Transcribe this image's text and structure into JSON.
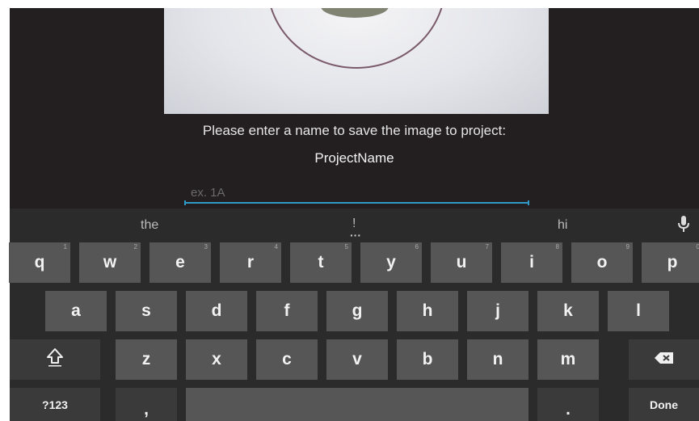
{
  "dialog": {
    "prompt": "Please enter a name to save the image to project:",
    "project_name": "ProjectName",
    "input": {
      "value": "",
      "placeholder": "ex. 1A"
    }
  },
  "keyboard": {
    "suggestions": {
      "left": "the",
      "center": "!",
      "right": "hi"
    },
    "row1": [
      {
        "label": "q",
        "hint": "1"
      },
      {
        "label": "w",
        "hint": "2"
      },
      {
        "label": "e",
        "hint": "3"
      },
      {
        "label": "r",
        "hint": "4"
      },
      {
        "label": "t",
        "hint": "5"
      },
      {
        "label": "y",
        "hint": "6"
      },
      {
        "label": "u",
        "hint": "7"
      },
      {
        "label": "i",
        "hint": "8"
      },
      {
        "label": "o",
        "hint": "9"
      },
      {
        "label": "p",
        "hint": "0"
      }
    ],
    "row2": [
      "a",
      "s",
      "d",
      "f",
      "g",
      "h",
      "j",
      "k",
      "l"
    ],
    "row3": [
      "z",
      "x",
      "c",
      "v",
      "b",
      "n",
      "m"
    ],
    "bottom": {
      "symbols": "?123",
      "comma": ",",
      "period": ".",
      "done": "Done"
    }
  },
  "colors": {
    "accent": "#2f9ac8",
    "key": "#565656",
    "key_dark": "#3a3a3a",
    "keyboard_bg": "#2b2b2b",
    "dialog_bg": "#231e1f"
  },
  "icons": [
    "mic-icon",
    "shift-icon",
    "backspace-icon"
  ]
}
